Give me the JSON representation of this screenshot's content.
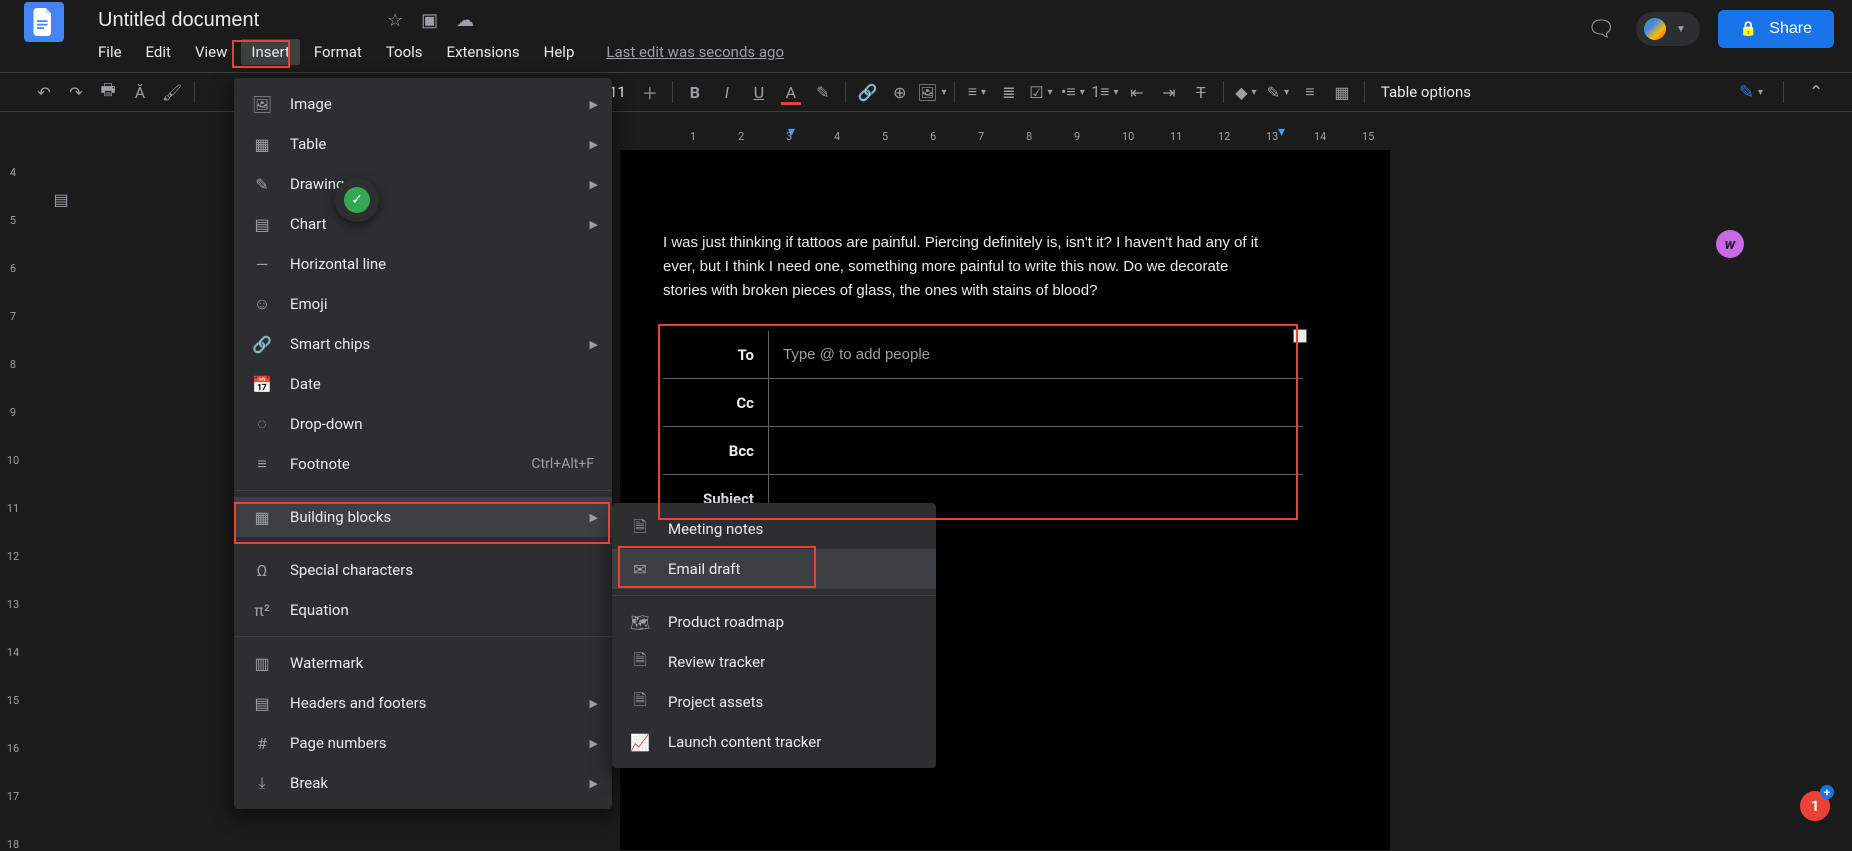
{
  "header": {
    "title": "Untitled document",
    "last_edit": "Last edit was seconds ago",
    "share": "Share",
    "menus": [
      "File",
      "Edit",
      "View",
      "Insert",
      "Format",
      "Tools",
      "Extensions",
      "Help"
    ],
    "active_menu_index": 3
  },
  "toolbar": {
    "font_size": "11",
    "table_options": "Table options"
  },
  "insert_menu": {
    "items": [
      {
        "icon": "🖼",
        "label": "Image",
        "sub": true
      },
      {
        "icon": "▦",
        "label": "Table",
        "sub": true
      },
      {
        "icon": "✎",
        "label": "Drawing",
        "sub": true
      },
      {
        "icon": "▤",
        "label": "Chart",
        "sub": true
      },
      {
        "icon": "—",
        "label": "Horizontal line"
      },
      {
        "icon": "☺",
        "label": "Emoji"
      },
      {
        "icon": "🔗",
        "label": "Smart chips",
        "sub": true
      },
      {
        "icon": "📅",
        "label": "Date"
      },
      {
        "icon": "◌",
        "label": "Drop-down"
      },
      {
        "icon": "≡",
        "label": "Footnote",
        "shortcut": "Ctrl+Alt+F"
      },
      {
        "divider": true
      },
      {
        "icon": "▦",
        "label": "Building blocks",
        "sub": true,
        "highlight": true
      },
      {
        "divider": true
      },
      {
        "icon": "Ω",
        "label": "Special characters"
      },
      {
        "icon": "π²",
        "label": "Equation"
      },
      {
        "divider": true
      },
      {
        "icon": "▥",
        "label": "Watermark"
      },
      {
        "icon": "▤",
        "label": "Headers and footers",
        "sub": true
      },
      {
        "icon": "#",
        "label": "Page numbers",
        "sub": true
      },
      {
        "icon": "�imag",
        "label": "Break",
        "sub": true,
        "iconraw": "⤓"
      }
    ]
  },
  "submenu": {
    "items": [
      {
        "icon": "🗎",
        "label": "Meeting notes"
      },
      {
        "icon": "✉",
        "label": "Email draft",
        "highlight": true
      },
      {
        "divider": true
      },
      {
        "icon": "🗺",
        "label": "Product roadmap"
      },
      {
        "icon": "🗎",
        "label": "Review tracker"
      },
      {
        "icon": "🗎",
        "label": "Project assets"
      },
      {
        "icon": "📈",
        "label": "Launch content tracker"
      }
    ]
  },
  "document": {
    "body_text": "I was just thinking if tattoos are painful. Piercing definitely is, isn't it? I haven't had any of it ever, but I think I need one, something more painful to write this now. Do we decorate stories with broken pieces of glass, the ones with stains of blood?",
    "email": {
      "to_label": "To",
      "to_placeholder": "Type @ to add people",
      "cc_label": "Cc",
      "bcc_label": "Bcc",
      "subject_label": "Subject"
    }
  },
  "ruler_numbers": [
    "1",
    "2",
    "3",
    "4",
    "5",
    "6",
    "7",
    "8",
    "9",
    "10",
    "11",
    "12",
    "13",
    "14",
    "15"
  ],
  "vruler_numbers": [
    "4",
    "5",
    "6",
    "7",
    "8",
    "9",
    "10",
    "11",
    "12",
    "13",
    "14",
    "15",
    "16",
    "17",
    "18"
  ],
  "notif_count": "1"
}
